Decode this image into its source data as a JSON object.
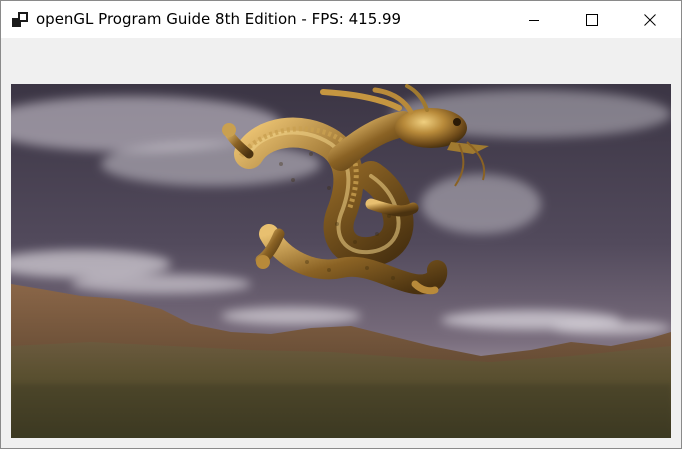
{
  "window": {
    "title": "openGL Program Guide 8th Edition - FPS: 415.99"
  },
  "titlebar": {
    "icons": {
      "app": "app-icon",
      "minimize": "minimize-icon",
      "maximize": "maximize-icon",
      "close": "close-icon"
    }
  },
  "scene": {
    "subject": "golden dragon model rendered over skybox",
    "colors": {
      "sky_top": "#3f3848",
      "sky_mid": "#5b5066",
      "horizon": "#9a8c9a",
      "mountain": "#7a5a42",
      "ground": "#4f4a2c",
      "gold_light": "#d9b060",
      "gold_dark": "#5a3c14"
    }
  }
}
